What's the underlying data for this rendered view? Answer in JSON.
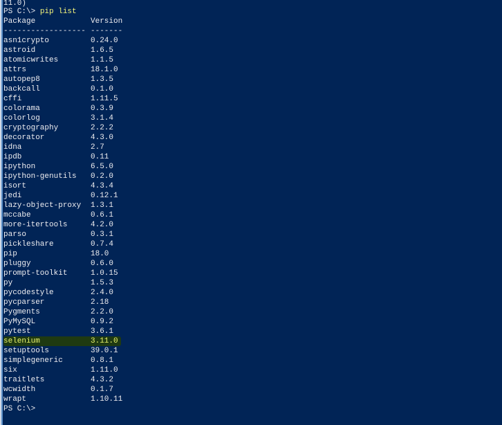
{
  "terminal": {
    "prior_output": "11.0)",
    "prompt": "PS C:\\> ",
    "command": "pip list",
    "header": {
      "package": "Package",
      "version": "Version"
    },
    "separator": {
      "package": "------------------",
      "version": "-------"
    },
    "packages": [
      {
        "name": "asn1crypto",
        "version": "0.24.0"
      },
      {
        "name": "astroid",
        "version": "1.6.5"
      },
      {
        "name": "atomicwrites",
        "version": "1.1.5"
      },
      {
        "name": "attrs",
        "version": "18.1.0"
      },
      {
        "name": "autopep8",
        "version": "1.3.5"
      },
      {
        "name": "backcall",
        "version": "0.1.0"
      },
      {
        "name": "cffi",
        "version": "1.11.5"
      },
      {
        "name": "colorama",
        "version": "0.3.9"
      },
      {
        "name": "colorlog",
        "version": "3.1.4"
      },
      {
        "name": "cryptography",
        "version": "2.2.2"
      },
      {
        "name": "decorator",
        "version": "4.3.0"
      },
      {
        "name": "idna",
        "version": "2.7"
      },
      {
        "name": "ipdb",
        "version": "0.11"
      },
      {
        "name": "ipython",
        "version": "6.5.0"
      },
      {
        "name": "ipython-genutils",
        "version": "0.2.0"
      },
      {
        "name": "isort",
        "version": "4.3.4"
      },
      {
        "name": "jedi",
        "version": "0.12.1"
      },
      {
        "name": "lazy-object-proxy",
        "version": "1.3.1"
      },
      {
        "name": "mccabe",
        "version": "0.6.1"
      },
      {
        "name": "more-itertools",
        "version": "4.2.0"
      },
      {
        "name": "parso",
        "version": "0.3.1"
      },
      {
        "name": "pickleshare",
        "version": "0.7.4"
      },
      {
        "name": "pip",
        "version": "18.0"
      },
      {
        "name": "pluggy",
        "version": "0.6.0"
      },
      {
        "name": "prompt-toolkit",
        "version": "1.0.15"
      },
      {
        "name": "py",
        "version": "1.5.3"
      },
      {
        "name": "pycodestyle",
        "version": "2.4.0"
      },
      {
        "name": "pycparser",
        "version": "2.18"
      },
      {
        "name": "Pygments",
        "version": "2.2.0"
      },
      {
        "name": "PyMySQL",
        "version": "0.9.2"
      },
      {
        "name": "pytest",
        "version": "3.6.1"
      },
      {
        "name": "selenium",
        "version": "3.11.0",
        "highlighted": true
      },
      {
        "name": "setuptools",
        "version": "39.0.1"
      },
      {
        "name": "simplegeneric",
        "version": "0.8.1"
      },
      {
        "name": "six",
        "version": "1.11.0"
      },
      {
        "name": "traitlets",
        "version": "4.3.2"
      },
      {
        "name": "wcwidth",
        "version": "0.1.7"
      },
      {
        "name": "wrapt",
        "version": "1.10.11"
      }
    ],
    "final_prompt": "PS C:\\>",
    "colors": {
      "background": "#012456",
      "text": "#eeedf0",
      "command": "#f3f57a",
      "highlight": "#1f3a12"
    }
  }
}
